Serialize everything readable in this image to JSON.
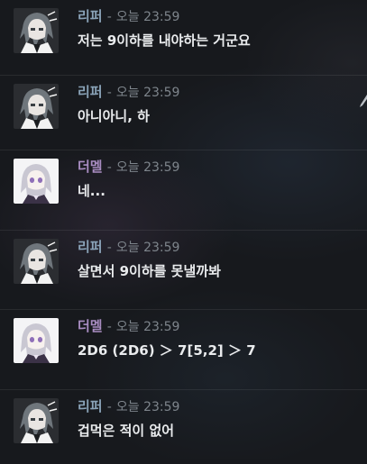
{
  "messages": [
    {
      "author": "리퍼",
      "author_color": "#8aa3b8",
      "separator": "-",
      "timestamp": "오늘 23:59",
      "text": "저는 9이하를 내야하는 거군요",
      "avatar": "gray-haired-character"
    },
    {
      "author": "리퍼",
      "author_color": "#8aa3b8",
      "separator": "-",
      "timestamp": "오늘 23:59",
      "text": "아니아니, 하",
      "avatar": "gray-haired-character"
    },
    {
      "author": "더멜",
      "author_color": "#a98dc2",
      "separator": "-",
      "timestamp": "오늘 23:59",
      "text": "네...",
      "avatar": "white-haired-character"
    },
    {
      "author": "리퍼",
      "author_color": "#8aa3b8",
      "separator": "-",
      "timestamp": "오늘 23:59",
      "text": "살면서 9이하를 못낼까봐",
      "avatar": "gray-haired-character"
    },
    {
      "author": "더멜",
      "author_color": "#a98dc2",
      "separator": "-",
      "timestamp": "오늘 23:59",
      "text": "2D6  (2D6) ＞ 7[5,2] ＞ 7",
      "avatar": "white-haired-character"
    },
    {
      "author": "리퍼",
      "author_color": "#8aa3b8",
      "separator": "-",
      "timestamp": "오늘 23:59",
      "text": "겁먹은 적이 없어",
      "avatar": "gray-haired-character"
    }
  ]
}
